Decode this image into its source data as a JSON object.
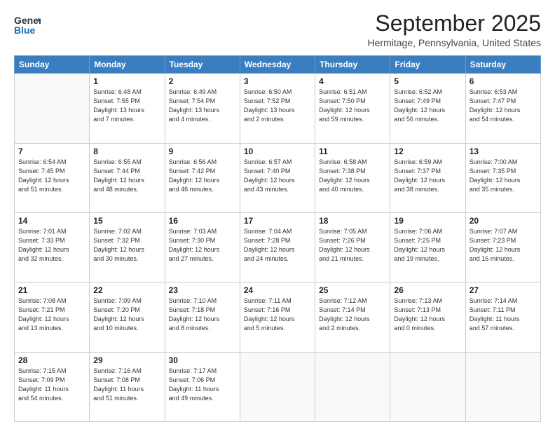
{
  "header": {
    "logo_general": "General",
    "logo_blue": "Blue",
    "month_title": "September 2025",
    "location": "Hermitage, Pennsylvania, United States"
  },
  "days_of_week": [
    "Sunday",
    "Monday",
    "Tuesday",
    "Wednesday",
    "Thursday",
    "Friday",
    "Saturday"
  ],
  "weeks": [
    [
      {
        "day": "",
        "info": ""
      },
      {
        "day": "1",
        "info": "Sunrise: 6:48 AM\nSunset: 7:55 PM\nDaylight: 13 hours\nand 7 minutes."
      },
      {
        "day": "2",
        "info": "Sunrise: 6:49 AM\nSunset: 7:54 PM\nDaylight: 13 hours\nand 4 minutes."
      },
      {
        "day": "3",
        "info": "Sunrise: 6:50 AM\nSunset: 7:52 PM\nDaylight: 13 hours\nand 2 minutes."
      },
      {
        "day": "4",
        "info": "Sunrise: 6:51 AM\nSunset: 7:50 PM\nDaylight: 12 hours\nand 59 minutes."
      },
      {
        "day": "5",
        "info": "Sunrise: 6:52 AM\nSunset: 7:49 PM\nDaylight: 12 hours\nand 56 minutes."
      },
      {
        "day": "6",
        "info": "Sunrise: 6:53 AM\nSunset: 7:47 PM\nDaylight: 12 hours\nand 54 minutes."
      }
    ],
    [
      {
        "day": "7",
        "info": "Sunrise: 6:54 AM\nSunset: 7:45 PM\nDaylight: 12 hours\nand 51 minutes."
      },
      {
        "day": "8",
        "info": "Sunrise: 6:55 AM\nSunset: 7:44 PM\nDaylight: 12 hours\nand 48 minutes."
      },
      {
        "day": "9",
        "info": "Sunrise: 6:56 AM\nSunset: 7:42 PM\nDaylight: 12 hours\nand 46 minutes."
      },
      {
        "day": "10",
        "info": "Sunrise: 6:57 AM\nSunset: 7:40 PM\nDaylight: 12 hours\nand 43 minutes."
      },
      {
        "day": "11",
        "info": "Sunrise: 6:58 AM\nSunset: 7:38 PM\nDaylight: 12 hours\nand 40 minutes."
      },
      {
        "day": "12",
        "info": "Sunrise: 6:59 AM\nSunset: 7:37 PM\nDaylight: 12 hours\nand 38 minutes."
      },
      {
        "day": "13",
        "info": "Sunrise: 7:00 AM\nSunset: 7:35 PM\nDaylight: 12 hours\nand 35 minutes."
      }
    ],
    [
      {
        "day": "14",
        "info": "Sunrise: 7:01 AM\nSunset: 7:33 PM\nDaylight: 12 hours\nand 32 minutes."
      },
      {
        "day": "15",
        "info": "Sunrise: 7:02 AM\nSunset: 7:32 PM\nDaylight: 12 hours\nand 30 minutes."
      },
      {
        "day": "16",
        "info": "Sunrise: 7:03 AM\nSunset: 7:30 PM\nDaylight: 12 hours\nand 27 minutes."
      },
      {
        "day": "17",
        "info": "Sunrise: 7:04 AM\nSunset: 7:28 PM\nDaylight: 12 hours\nand 24 minutes."
      },
      {
        "day": "18",
        "info": "Sunrise: 7:05 AM\nSunset: 7:26 PM\nDaylight: 12 hours\nand 21 minutes."
      },
      {
        "day": "19",
        "info": "Sunrise: 7:06 AM\nSunset: 7:25 PM\nDaylight: 12 hours\nand 19 minutes."
      },
      {
        "day": "20",
        "info": "Sunrise: 7:07 AM\nSunset: 7:23 PM\nDaylight: 12 hours\nand 16 minutes."
      }
    ],
    [
      {
        "day": "21",
        "info": "Sunrise: 7:08 AM\nSunset: 7:21 PM\nDaylight: 12 hours\nand 13 minutes."
      },
      {
        "day": "22",
        "info": "Sunrise: 7:09 AM\nSunset: 7:20 PM\nDaylight: 12 hours\nand 10 minutes."
      },
      {
        "day": "23",
        "info": "Sunrise: 7:10 AM\nSunset: 7:18 PM\nDaylight: 12 hours\nand 8 minutes."
      },
      {
        "day": "24",
        "info": "Sunrise: 7:11 AM\nSunset: 7:16 PM\nDaylight: 12 hours\nand 5 minutes."
      },
      {
        "day": "25",
        "info": "Sunrise: 7:12 AM\nSunset: 7:14 PM\nDaylight: 12 hours\nand 2 minutes."
      },
      {
        "day": "26",
        "info": "Sunrise: 7:13 AM\nSunset: 7:13 PM\nDaylight: 12 hours\nand 0 minutes."
      },
      {
        "day": "27",
        "info": "Sunrise: 7:14 AM\nSunset: 7:11 PM\nDaylight: 11 hours\nand 57 minutes."
      }
    ],
    [
      {
        "day": "28",
        "info": "Sunrise: 7:15 AM\nSunset: 7:09 PM\nDaylight: 11 hours\nand 54 minutes."
      },
      {
        "day": "29",
        "info": "Sunrise: 7:16 AM\nSunset: 7:08 PM\nDaylight: 11 hours\nand 51 minutes."
      },
      {
        "day": "30",
        "info": "Sunrise: 7:17 AM\nSunset: 7:06 PM\nDaylight: 11 hours\nand 49 minutes."
      },
      {
        "day": "",
        "info": ""
      },
      {
        "day": "",
        "info": ""
      },
      {
        "day": "",
        "info": ""
      },
      {
        "day": "",
        "info": ""
      }
    ]
  ]
}
